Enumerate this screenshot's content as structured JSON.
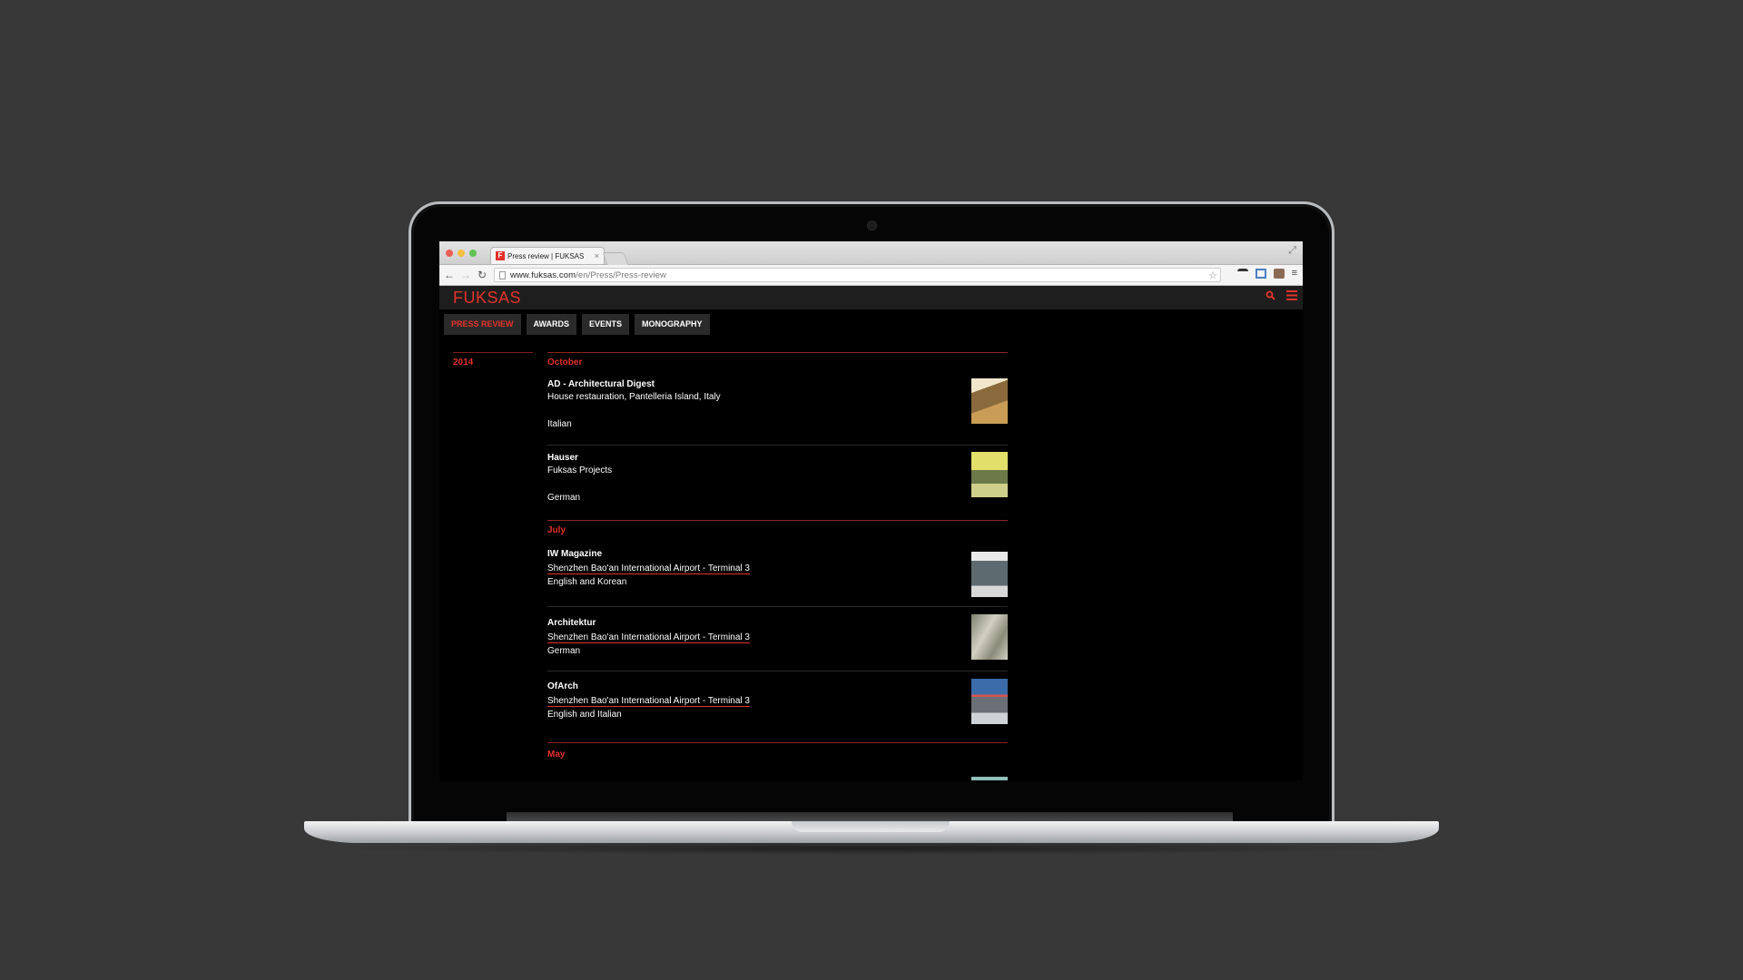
{
  "browser": {
    "tab_title": "Press review | FUKSAS",
    "favicon_letter": "F",
    "url_host": "www.fuksas.com",
    "url_path": "/en/Press/Press-review"
  },
  "site": {
    "logo": "FUKSAS",
    "accent_color": "#e4322a"
  },
  "section_nav": {
    "items": [
      {
        "label": "PRESS REVIEW",
        "active": true
      },
      {
        "label": "AWARDS"
      },
      {
        "label": "EVENTS"
      },
      {
        "label": "MONOGRAPHY"
      }
    ]
  },
  "press_review": {
    "year": "2014",
    "months": [
      {
        "name": "October",
        "items": [
          {
            "magazine": "AD - Architectural Digest",
            "subject": "House restauration, Pantelleria Island, Italy",
            "language": "Italian"
          },
          {
            "magazine": "Hauser",
            "subject": "Fuksas Projects",
            "language": "German"
          }
        ]
      },
      {
        "name": "July",
        "items": [
          {
            "magazine": "IW Magazine",
            "subject": "Shenzhen Bao'an International Airport - Terminal 3",
            "language": "English and Korean"
          },
          {
            "magazine": "Architektur",
            "subject": "Shenzhen Bao'an International Airport - Terminal 3",
            "language": "German"
          },
          {
            "magazine": "OfArch",
            "subject": "Shenzhen Bao'an International Airport - Terminal 3",
            "language": "English and Italian"
          }
        ]
      },
      {
        "name": "May",
        "items": []
      }
    ]
  },
  "icons": {
    "search": "search-icon",
    "menu": "hamburger-menu-icon",
    "back": "back-arrow-icon",
    "forward": "forward-arrow-icon",
    "reload": "reload-icon",
    "bookmark": "star-icon"
  }
}
